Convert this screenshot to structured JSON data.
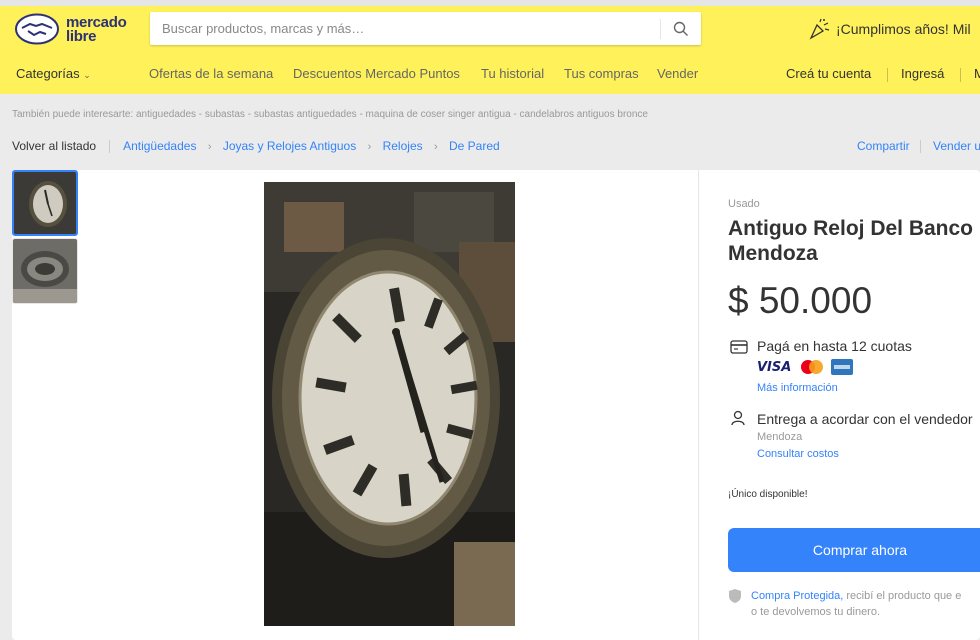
{
  "brand": {
    "line1": "mercado",
    "line2": "libre",
    "primary_color": "#fff159",
    "accent_color": "#3483fa"
  },
  "search": {
    "placeholder": "Buscar productos, marcas y más…"
  },
  "promo": {
    "text": "¡Cumplimos años! Mil"
  },
  "nav": {
    "categories": "Categorías",
    "links": [
      "Ofertas de la semana",
      "Descuentos Mercado Puntos",
      "Tu historial",
      "Tus compras",
      "Vender"
    ],
    "account": [
      "Creá tu cuenta",
      "Ingresá",
      "M"
    ]
  },
  "also_interested": "También puede interesarte: antiguedades - subastas - subastas antiguedades - maquina de coser singer antigua - candelabros antiguos bronce",
  "breadcrumb": {
    "back": "Volver al listado",
    "items": [
      "Antigüedades",
      "Joyas y Relojes Antiguos",
      "Relojes",
      "De Pared"
    ],
    "share": "Compartir",
    "sell": "Vender u"
  },
  "product": {
    "condition": "Usado",
    "title": "Antiguo Reloj Del Banco Mendoza",
    "price": "$ 50.000",
    "installments": "Pagá en hasta 12 cuotas",
    "card_brands": [
      "visa-logo",
      "mastercard-logo",
      "amex-logo"
    ],
    "visa_label": "VISA",
    "more_info": "Más información",
    "delivery": "Entrega a acordar con el vendedor",
    "location": "Mendoza",
    "shipping_link": "Consultar costos",
    "stock": "¡Único disponible!",
    "buy_button": "Comprar ahora",
    "protected_link": "Compra Protegida,",
    "protected_text": " recibí el producto que e",
    "protected_text2": "o te devolvemos tu dinero."
  }
}
